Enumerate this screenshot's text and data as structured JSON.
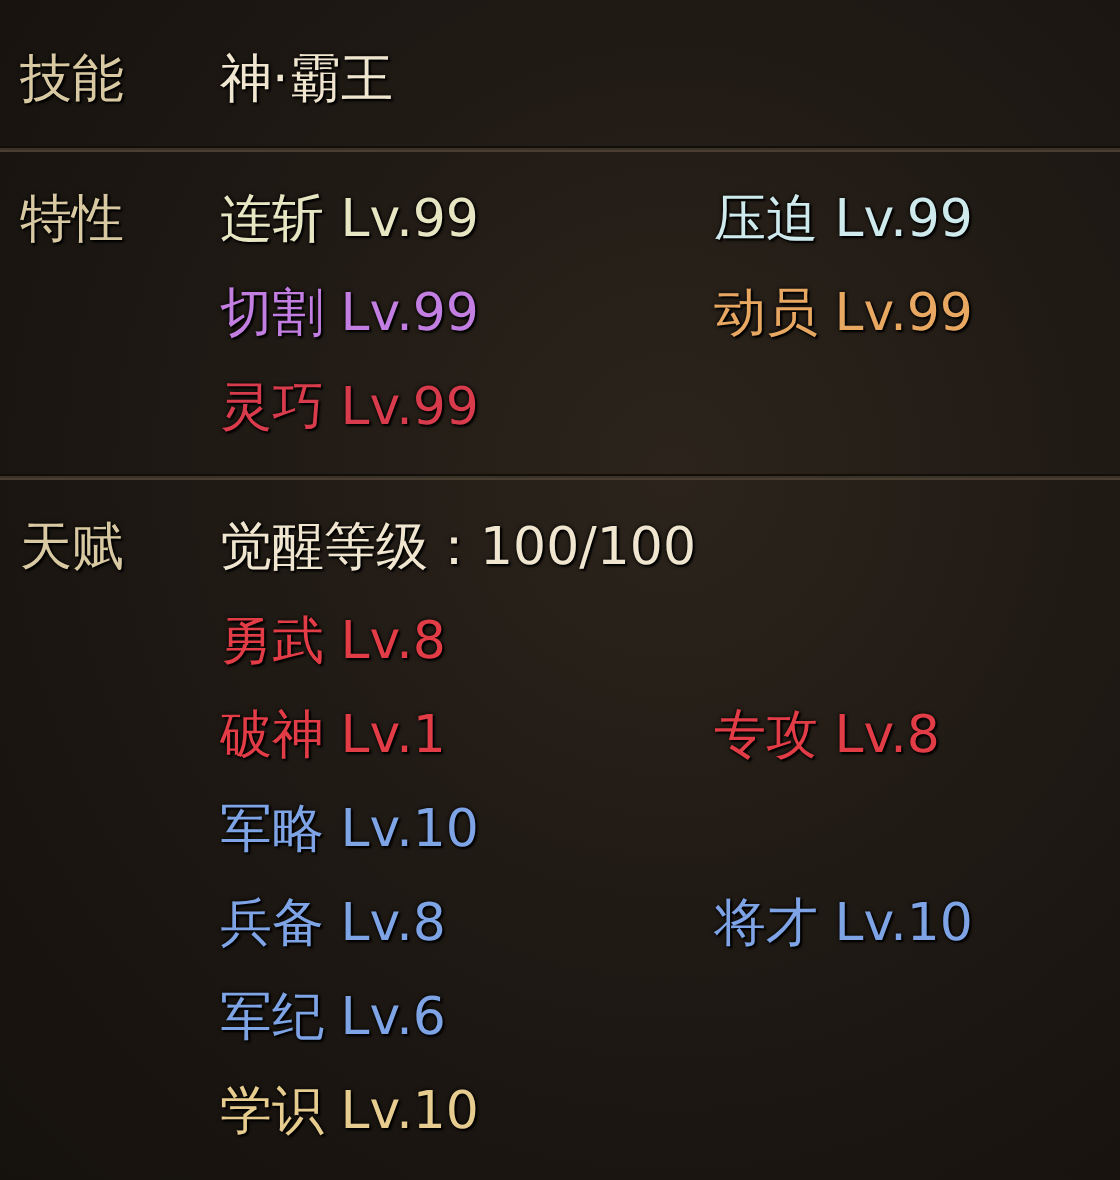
{
  "skill": {
    "label": "技能",
    "value": "神·霸王"
  },
  "traits": {
    "label": "特性",
    "rows": [
      [
        {
          "text": "连斩 Lv.99",
          "color": "#e6e6c2"
        },
        {
          "text": "压迫 Lv.99",
          "color": "#cfeaec"
        }
      ],
      [
        {
          "text": "切割 Lv.99",
          "color": "#c27ee0"
        },
        {
          "text": "动员 Lv.99",
          "color": "#e8a862"
        }
      ],
      [
        {
          "text": "灵巧 Lv.99",
          "color": "#d83c4c"
        }
      ]
    ]
  },
  "talents": {
    "label": "天赋",
    "awakening": "觉醒等级：100/100",
    "rows": [
      [
        {
          "text": "勇武 Lv.8",
          "color": "#e23c46"
        }
      ],
      [
        {
          "text": "破神 Lv.1",
          "color": "#e23c46"
        },
        {
          "text": "专攻 Lv.8",
          "color": "#e23c46"
        }
      ],
      [
        {
          "text": "军略 Lv.10",
          "color": "#7ea4e6"
        }
      ],
      [
        {
          "text": "兵备 Lv.8",
          "color": "#7ea4e6"
        },
        {
          "text": "将才 Lv.10",
          "color": "#7ea4e6"
        }
      ],
      [
        {
          "text": "军纪 Lv.6",
          "color": "#7ea4e6"
        }
      ],
      [
        {
          "text": "学识 Lv.10",
          "color": "#e6cc8e"
        }
      ]
    ]
  }
}
